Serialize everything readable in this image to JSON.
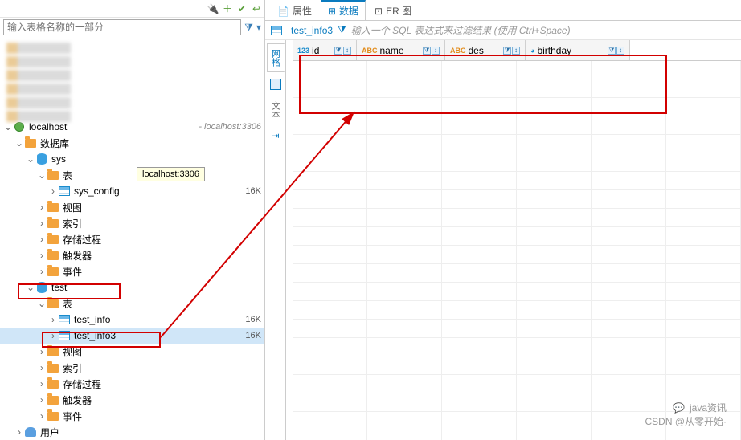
{
  "left": {
    "search_placeholder": "输入表格名称的一部分",
    "tooltip": "localhost:3306",
    "connection": {
      "name": "localhost",
      "addr": "- localhost:3306"
    },
    "nodes": {
      "databases": "数据库",
      "sys": "sys",
      "tables": "表",
      "sys_config": "sys_config",
      "sys_config_size": "16K",
      "views": "视图",
      "indexes": "索引",
      "procedures": "存储过程",
      "triggers": "触发器",
      "events": "事件",
      "test": "test",
      "test_info": "test_info",
      "test_info_size": "16K",
      "test_info3": "test_info3",
      "test_info3_size": "16K",
      "users": "用户"
    }
  },
  "right": {
    "tabs": {
      "properties": "属性",
      "data": "数据",
      "er": "ER 图"
    },
    "subtab": {
      "table_name": "test_info3",
      "filter_hint": "输入一个 SQL 表达式来过滤结果 (使用 Ctrl+Space)"
    },
    "side_tabs": {
      "grid": "网格",
      "text": "文本"
    },
    "columns": {
      "id": "id",
      "name": "name",
      "des": "des",
      "birthday": "birthday"
    }
  },
  "watermark": {
    "line1": "java资讯",
    "line2": "CSDN @从零开始·"
  }
}
